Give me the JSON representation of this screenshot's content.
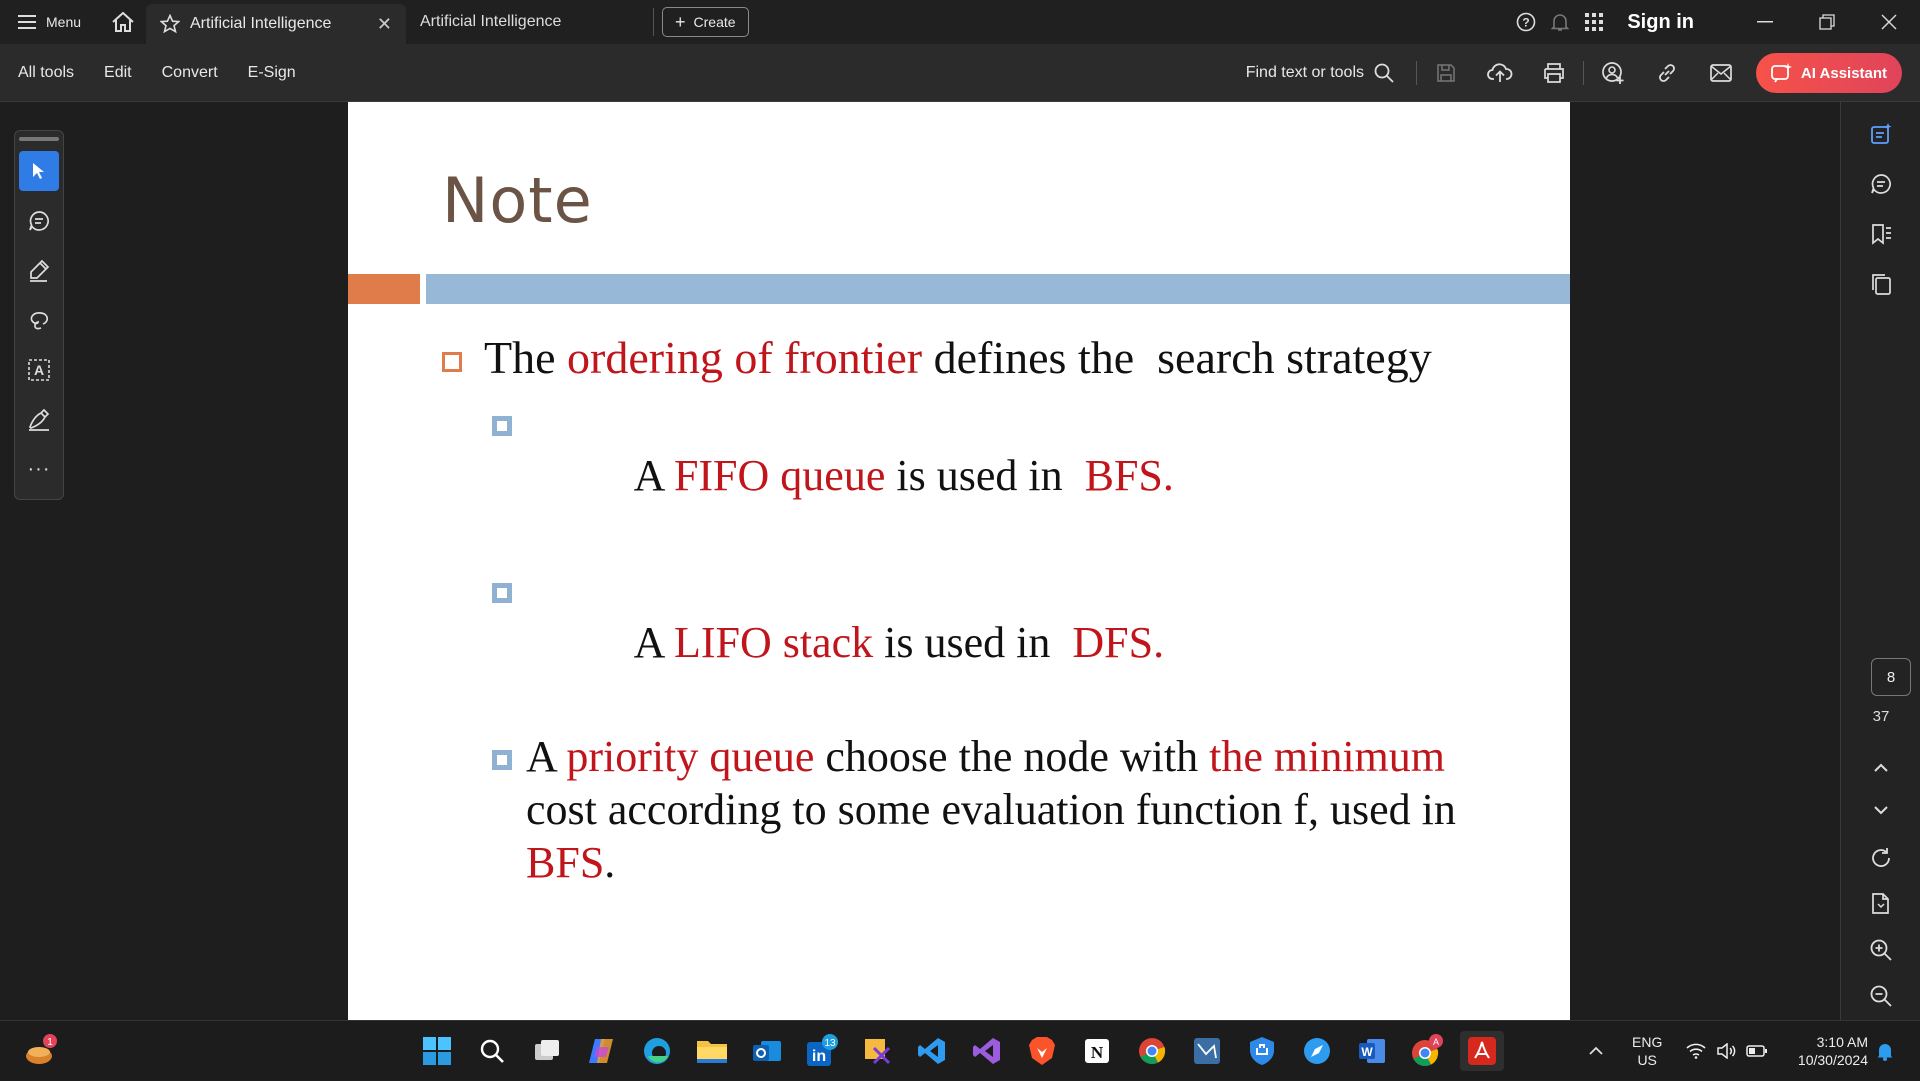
{
  "titlebar": {
    "menu_label": "Menu",
    "active_tab": "Artificial Intelligence",
    "inactive_tab": "Artificial Intelligence",
    "create_label": "Create",
    "signin_label": "Sign in"
  },
  "toolbar": {
    "menus": [
      "All tools",
      "Edit",
      "Convert",
      "E-Sign"
    ],
    "find_label": "Find text or tools",
    "ai_label": "AI Assistant"
  },
  "slide": {
    "title": "Note",
    "bullet1": {
      "t1": "The ",
      "r1": "ordering of frontier",
      "t2": " defines the  search strategy"
    },
    "sub1": {
      "t1": "A ",
      "r1": "FIFO queue",
      "t2": " is used in  ",
      "r2": "BFS."
    },
    "sub2": {
      "t1": "A ",
      "r1": "LIFO stack",
      "t2": " is used in  ",
      "r2": "DFS."
    },
    "sub3": {
      "t1": "A ",
      "r1": "priority queue",
      "t2": " choose the node with ",
      "r2": "the minimum",
      "t3": " cost according to some evaluation function f, used in ",
      "r3": "BFS",
      "t4": "."
    }
  },
  "navigation": {
    "current_page": "8",
    "total_pages": "37"
  },
  "taskbar": {
    "widget_badge": "1",
    "linkedin_badge": "13",
    "chrome_badge": "A",
    "lang_line1": "ENG",
    "lang_line2": "US",
    "time": "3:10 AM",
    "date": "10/30/2024"
  }
}
